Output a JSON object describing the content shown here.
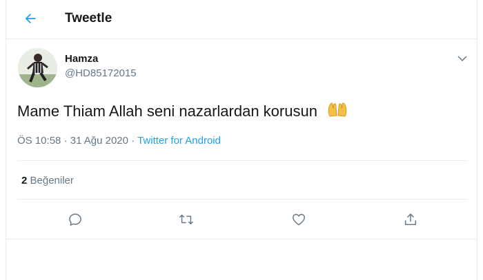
{
  "header": {
    "title": "Tweetle",
    "back_icon": "arrow-left-icon"
  },
  "accent_color": "#1da1f2",
  "tweet": {
    "author_name": "Hamza",
    "author_handle": "@HD85172015",
    "text": "Mame Thiam Allah seni nazarlardan korusun",
    "emoji": "raised-hands-emoji",
    "time": "ÖS 10:58",
    "separator": "·",
    "date": "31 Ağu 2020",
    "source": "Twitter for Android",
    "likes_count": "2",
    "likes_label": "Beğeniler"
  },
  "actions": [
    "reply-icon",
    "retweet-icon",
    "like-icon",
    "share-icon"
  ]
}
